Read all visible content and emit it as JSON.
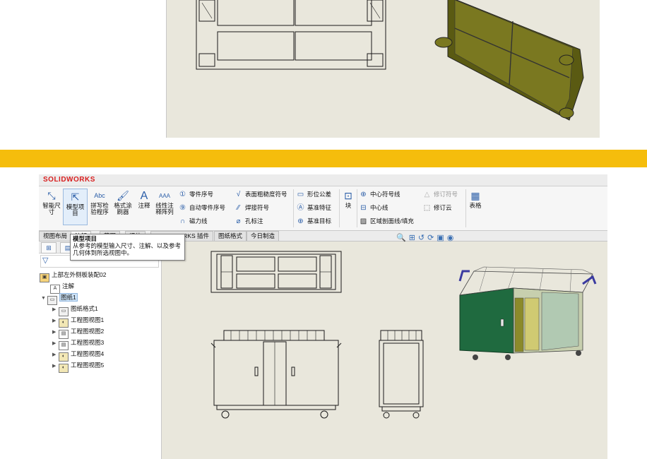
{
  "app": {
    "logo_text": "SOLIDWORKS"
  },
  "ribbon": {
    "smart_dim": "智能尺寸",
    "model_items": "模型项目",
    "spell_check": "拼写检验程序",
    "format_painter": "格式涂刷器",
    "note": "注释",
    "linear_note_pattern": "线性注释阵列",
    "balloon": "零件序号",
    "auto_balloon": "自动零件序号",
    "magnetic_line": "磁力线",
    "surface_finish": "表面粗糙度符号",
    "weld_symbol": "焊接符号",
    "hole_callout": "孔标注",
    "gtol": "形位公差",
    "datum_feature": "基准特征",
    "datum_target": "基准目标",
    "block": "块",
    "center_mark": "中心符号线",
    "centerline": "中心线",
    "area_hatch": "区域剖面线/填充",
    "revision_symbol": "修订符号",
    "revision_cloud": "修订云",
    "table": "表格"
  },
  "tabs": [
    "视图布局",
    "注解",
    "草图",
    "评估",
    "SOLIDWORKS 插件",
    "图纸格式",
    "今日制造"
  ],
  "tooltip": {
    "title": "模型项目",
    "body": "从参考的模型输入尺寸、注解、以及参考几何体到所选视图中。"
  },
  "tree": {
    "root": "上部左外侧板装配02",
    "annotations": "注解",
    "sheet": "图纸1",
    "children": [
      "图纸格式1",
      "工程图视图1",
      "工程图视图2",
      "工程图视图3",
      "工程图视图4",
      "工程图视图5"
    ]
  },
  "colors": {
    "band": "#f5bd0c",
    "canvas": "#e9e7dc",
    "cabinet": "#1f6a3f",
    "frame": "#3a3aa0",
    "panel_3d": "#6b6a16"
  }
}
